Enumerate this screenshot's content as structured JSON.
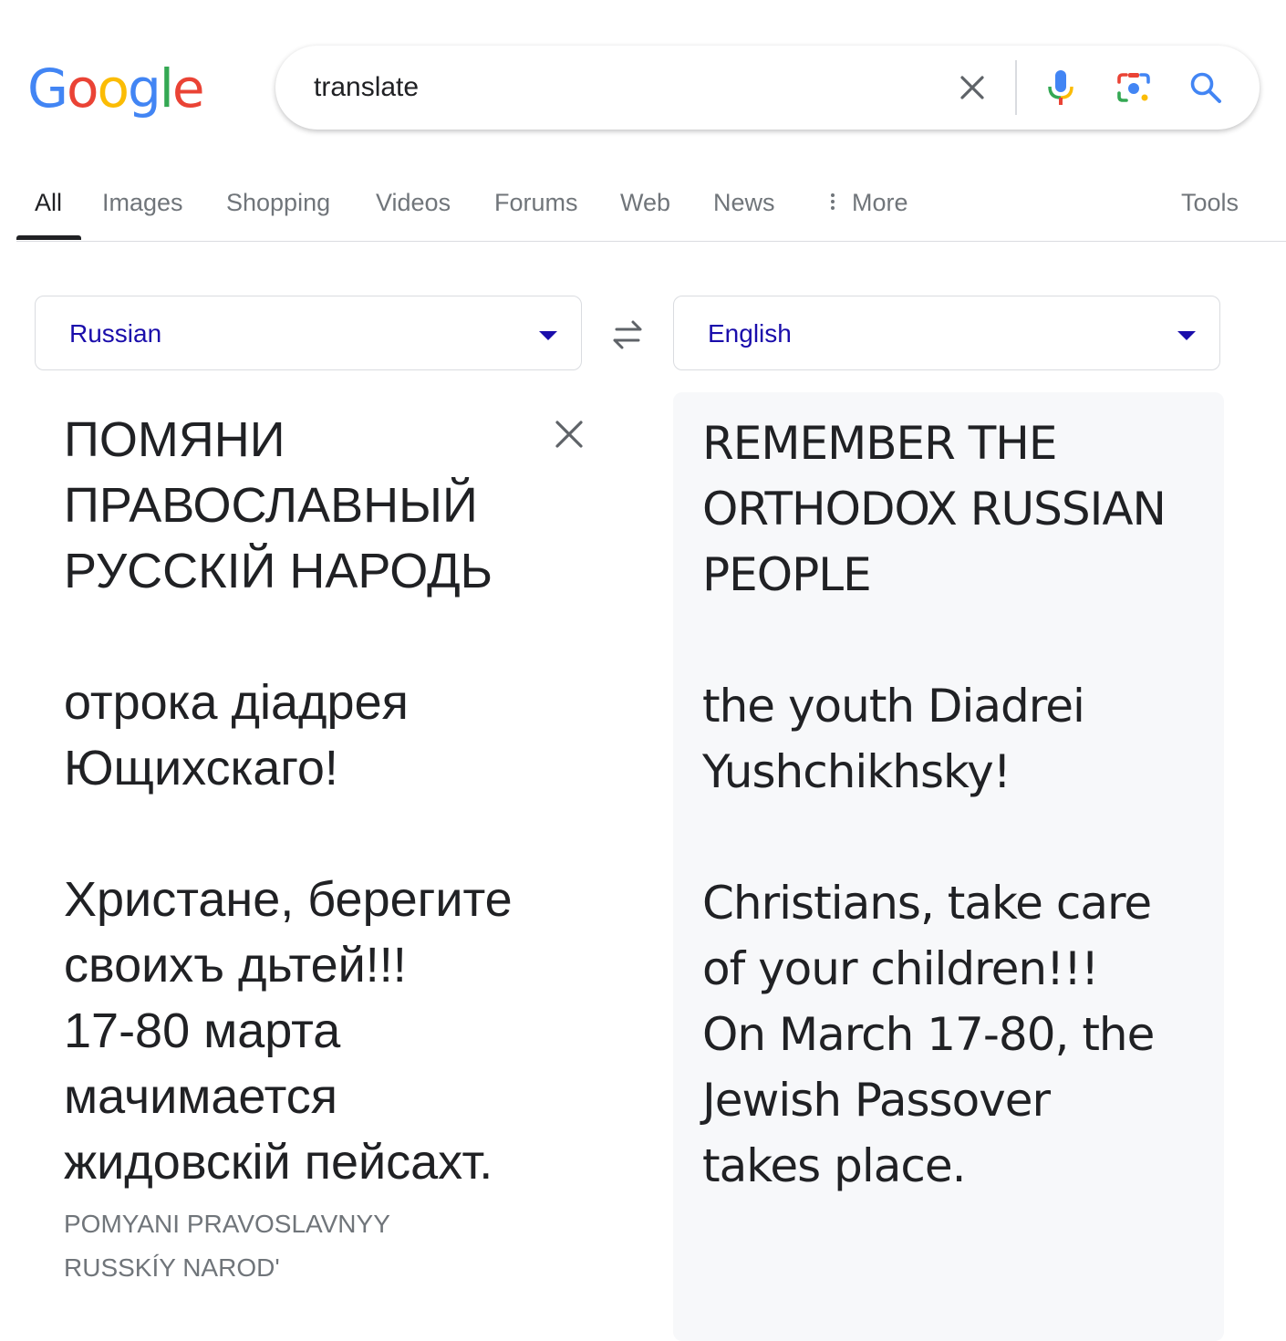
{
  "logo": {
    "letters": [
      "G",
      "o",
      "o",
      "g",
      "l",
      "e"
    ],
    "colors": [
      "#4285f4",
      "#ea4335",
      "#fbbc05",
      "#4285f4",
      "#34a853",
      "#ea4335"
    ]
  },
  "search": {
    "query": "translate",
    "placeholder": ""
  },
  "tabs": [
    {
      "label": "All",
      "active": true
    },
    {
      "label": "Images"
    },
    {
      "label": "Shopping"
    },
    {
      "label": "Videos"
    },
    {
      "label": "Forums"
    },
    {
      "label": "Web"
    },
    {
      "label": "News"
    },
    {
      "label": "More"
    }
  ],
  "tools_label": "Tools",
  "translator": {
    "source_language": "Russian",
    "target_language": "English",
    "source_text": "ПОМЯНИ\nПРАВОСЛАВНЫЙ\nРУССКІЙ НАРОДЬ\n\nотрока діадрея\nЮщихскаго!\n\nХристане, берегите\nсвоихъ дьтей!!!\n17-80 марта\nмачимается\nжидовскій пейсахт.",
    "transliteration": "POMYANI PRAVOSLAVNYY\nRUSSKÍY NAROD'",
    "translated_text": "REMEMBER THE\nORTHODOX RUSSIAN\nPEOPLE\n\nthe youth Diadrei\nYushchikhsky!\n\nChristians, take care\nof your children!!!\nOn March 17-80, the\nJewish Passover\ntakes place."
  },
  "colors": {
    "link_blue": "#1a0dab",
    "muted_gray": "#70757a",
    "target_pane_bg": "#f7f8fa"
  }
}
